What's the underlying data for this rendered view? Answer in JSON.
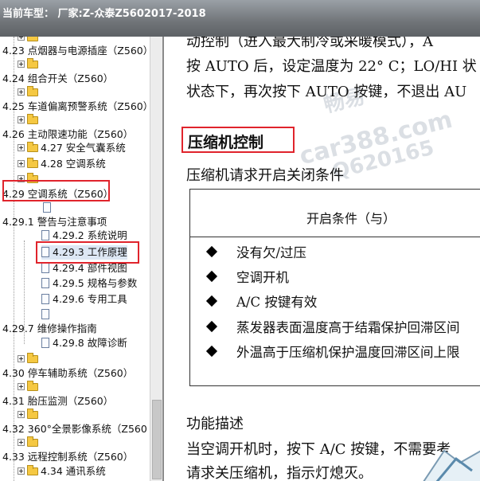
{
  "window": {
    "title": "当前车型：  厂家:Z-众泰Z5602017-2018"
  },
  "tree": {
    "item_423": "4.23 点烟器与电源插座（Z560）",
    "item_424": "4.24 组合开关（Z560）",
    "item_425": "4.25 车道偏离预警系统（Z560）",
    "item_426": "4.26 主动限速功能（Z560）",
    "item_427": "4.27 安全气囊系统",
    "item_428": "4.28 空调系统",
    "item_429": "4.29 空调系统（Z560）",
    "item_4291": "4.29.1 警告与注意事项",
    "item_4292": "4.29.2 系统说明",
    "item_4293": "4.29.3 工作原理",
    "item_4294": "4.29.4 部件视图",
    "item_4295": "4.29.5 规格与参数",
    "item_4296": "4.29.6 专用工具",
    "item_4297": "4.29.7 维修操作指南",
    "item_4298": "4.29.8 故障诊断",
    "item_430": "4.30 停车辅助系统（Z560）",
    "item_431": "4.31 胎压监测（Z560）",
    "item_432": "4.32 360°全景影像系统（Z560",
    "item_433": "4.33 远程控制系统（Z560）",
    "item_434": "4.34 通讯系统"
  },
  "content": {
    "line1": "动控制（进入最大制冷或采暖模式），A",
    "line2": "按 AUTO 后，设定温度为 22° C；LO/HI 状",
    "line3": "状态下，再次按下 AUTO 按键，不退出 AU",
    "section_title": "压缩机控制",
    "subtitle": "压缩机请求开启关闭条件",
    "table_header": "开启条件（与）",
    "conditions": [
      "没有欠/过压",
      "空调开机",
      "A/C 按键有效",
      "蒸发器表面温度高于结霜保护回滞区间",
      "外温高于压缩机保护温度回滞区间上限"
    ],
    "func_title": "功能描述",
    "func_line1": "当空调开机时，按下 A/C 按键，不需要考",
    "func_line2": "请求关压缩机，指示灯熄灭。"
  },
  "watermark": {
    "w1": "畅易",
    "w2": "car388.com",
    "w3": "Q620165"
  },
  "colors": {
    "highlight_box": "#e0242c",
    "folder": "#f5c842"
  }
}
